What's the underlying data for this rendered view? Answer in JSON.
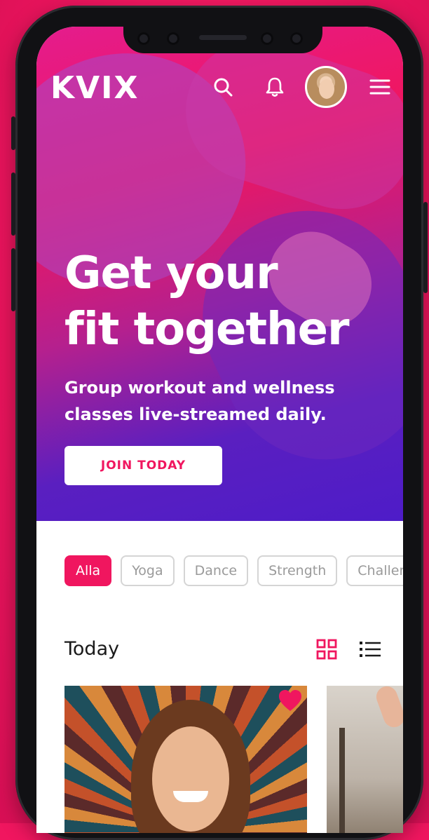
{
  "app": {
    "logo": "KVIX",
    "accent_color": "#f0165f",
    "header_icons": [
      "search-icon",
      "bell-icon",
      "avatar",
      "menu-icon"
    ]
  },
  "hero": {
    "title_line1": "Get your",
    "title_line2": "fit together",
    "subtitle_line1": "Group workout and wellness",
    "subtitle_line2": "classes live-streamed daily.",
    "cta_label": "JOIN TODAY"
  },
  "filters": {
    "active": "Alla",
    "items": [
      "Alla",
      "Yoga",
      "Dance",
      "Strength",
      "Challeng"
    ]
  },
  "section": {
    "title": "Today",
    "view_icons": [
      "grid-view-icon",
      "list-view-icon"
    ]
  }
}
